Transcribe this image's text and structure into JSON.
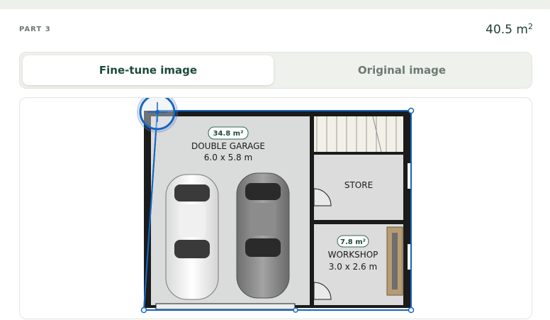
{
  "header": {
    "part_label": "PART 3",
    "area_value": "40.5 m",
    "area_unit_sup": "2"
  },
  "toggle": {
    "fine_tune_label": "Fine-tune image",
    "original_label": "Original image",
    "active": "fine_tune"
  },
  "plan": {
    "rooms": {
      "garage": {
        "area_badge": "34.8 m²",
        "name": "DOUBLE GARAGE",
        "dims": "6.0 x 5.8 m"
      },
      "store": {
        "name": "STORE"
      },
      "workshop": {
        "area_badge": "7.8 m²",
        "name": "WORKSHOP",
        "dims": "3.0 x 2.6 m"
      }
    }
  },
  "colors": {
    "accent_blue": "#1565c0",
    "wall": "#1b1b1b",
    "floor": "#dcdcdc",
    "badge_border": "#2e6b4f",
    "badge_text": "#1d4b3b"
  }
}
